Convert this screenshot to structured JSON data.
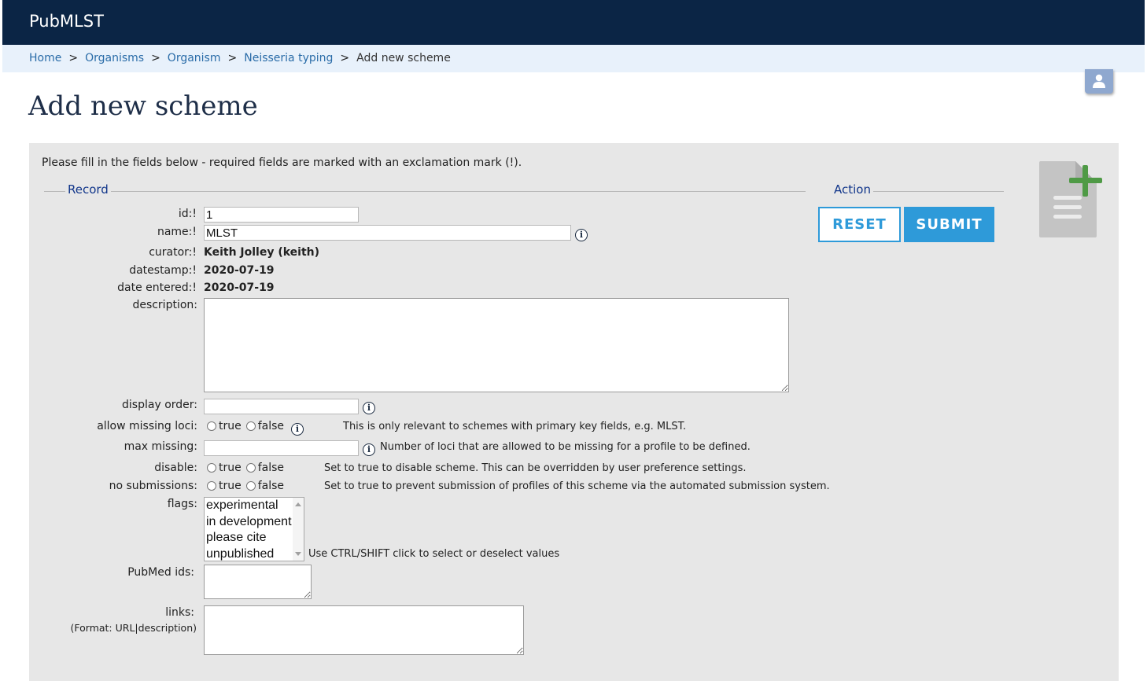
{
  "header": {
    "brand": "PubMLST"
  },
  "breadcrumb": {
    "items": [
      "Home",
      "Organisms",
      "Organism",
      "Neisseria typing"
    ],
    "separator": ">",
    "current": "Add new scheme"
  },
  "page": {
    "title": "Add new scheme"
  },
  "form": {
    "intro": "Please fill in the fields below - required fields are marked with an exclamation mark (!).",
    "record_legend": "Record",
    "action_legend": "Action",
    "fields": {
      "id": {
        "label": "id:!",
        "value": "1"
      },
      "name": {
        "label": "name:!",
        "value": "MLST"
      },
      "curator": {
        "label": "curator:!",
        "value": "Keith Jolley (keith)"
      },
      "datestamp": {
        "label": "datestamp:!",
        "value": "2020-07-19"
      },
      "date_entered": {
        "label": "date entered:!",
        "value": "2020-07-19"
      },
      "description": {
        "label": "description:",
        "value": ""
      },
      "display_order": {
        "label": "display order:",
        "value": ""
      },
      "allow_missing_loci": {
        "label": "allow missing loci:",
        "options": [
          "true",
          "false"
        ],
        "note": "This is only relevant to schemes with primary key fields, e.g. MLST."
      },
      "max_missing": {
        "label": "max missing:",
        "value": "",
        "note": "Number of loci that are allowed to be missing for a profile to be defined."
      },
      "disable": {
        "label": "disable:",
        "options": [
          "true",
          "false"
        ],
        "note": "Set to true to disable scheme. This can be overridden by user preference settings."
      },
      "no_submissions": {
        "label": "no submissions:",
        "options": [
          "true",
          "false"
        ],
        "note": "Set to true to prevent submission of profiles of this scheme via the automated submission system."
      },
      "flags": {
        "label": "flags:",
        "options": [
          "experimental",
          "in development",
          "please cite",
          "unpublished"
        ],
        "note": "Use CTRL/SHIFT click to select or deselect values"
      },
      "pubmed_ids": {
        "label": "PubMed ids:",
        "value": ""
      },
      "links": {
        "label": "links:",
        "hint": "(Format: URL|description)",
        "value": ""
      }
    },
    "buttons": {
      "reset": "RESET",
      "submit": "SUBMIT"
    }
  },
  "icons": {
    "user": "user-icon",
    "info": "info-icon",
    "add_document": "add-document-icon"
  },
  "colors": {
    "topbar": "#0b2545",
    "crumbbar": "#e8f1fb",
    "panel": "#e7e7e7",
    "button_accent": "#2e9ad9",
    "legend": "#10358a"
  }
}
